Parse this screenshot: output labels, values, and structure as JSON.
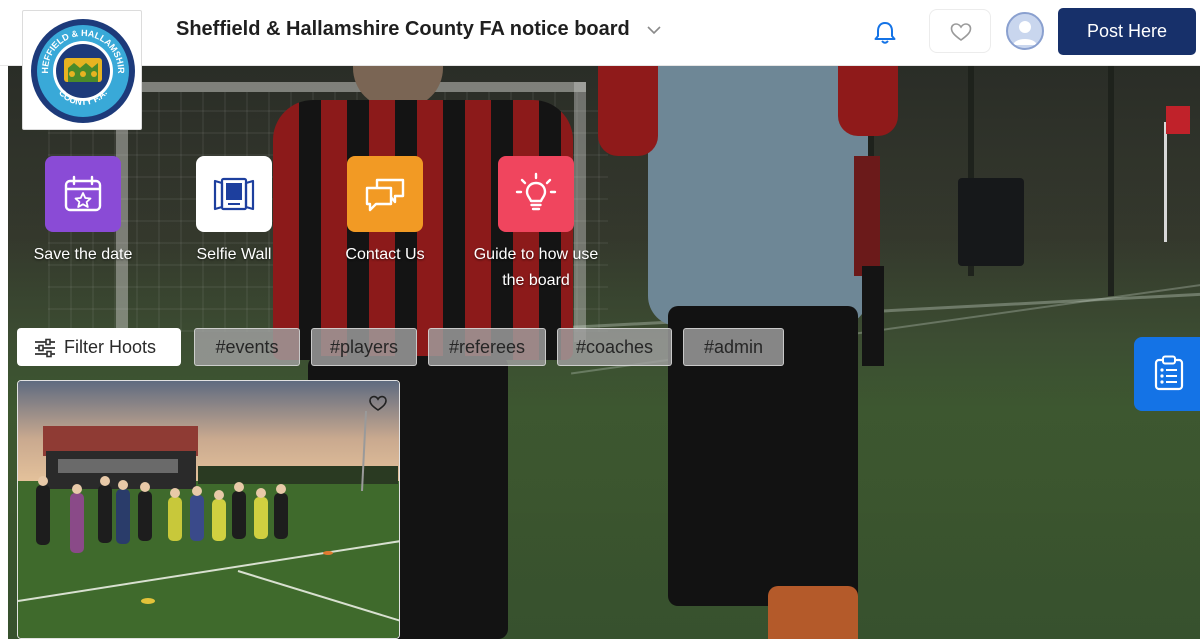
{
  "header": {
    "board_title": "Sheffield & Hallamshire County FA notice board",
    "post_button": "Post Here"
  },
  "logo": {
    "ring_text_top": "SHEFFIELD & HALLAMSHIRE",
    "ring_text_bottom": "COUNTY F.A."
  },
  "quick_links": [
    {
      "label": "Save the date",
      "icon": "calendar-star-icon",
      "color": "#8a4bd6"
    },
    {
      "label": "Selfie Wall",
      "icon": "photo-frame-icon",
      "color": "#ffffff"
    },
    {
      "label": "Contact Us",
      "icon": "chat-bubbles-icon",
      "color": "#f29a24"
    },
    {
      "label": "Guide to how use the board",
      "icon": "lightbulb-icon",
      "color": "#f0455e"
    }
  ],
  "filters": {
    "filter_button": "Filter Hoots",
    "tags": [
      "#events",
      "#players",
      "#referees",
      "#coaches",
      "#admin"
    ]
  },
  "icons": {
    "notification": "bell-icon",
    "favourites": "heart-icon",
    "profile": "user-avatar-icon",
    "side_panel": "clipboard-list-icon"
  },
  "colors": {
    "brand_navy": "#17306a",
    "accent_blue": "#1473e6",
    "logo_navy": "#1d3a7a",
    "logo_cyan": "#39a9d8"
  }
}
